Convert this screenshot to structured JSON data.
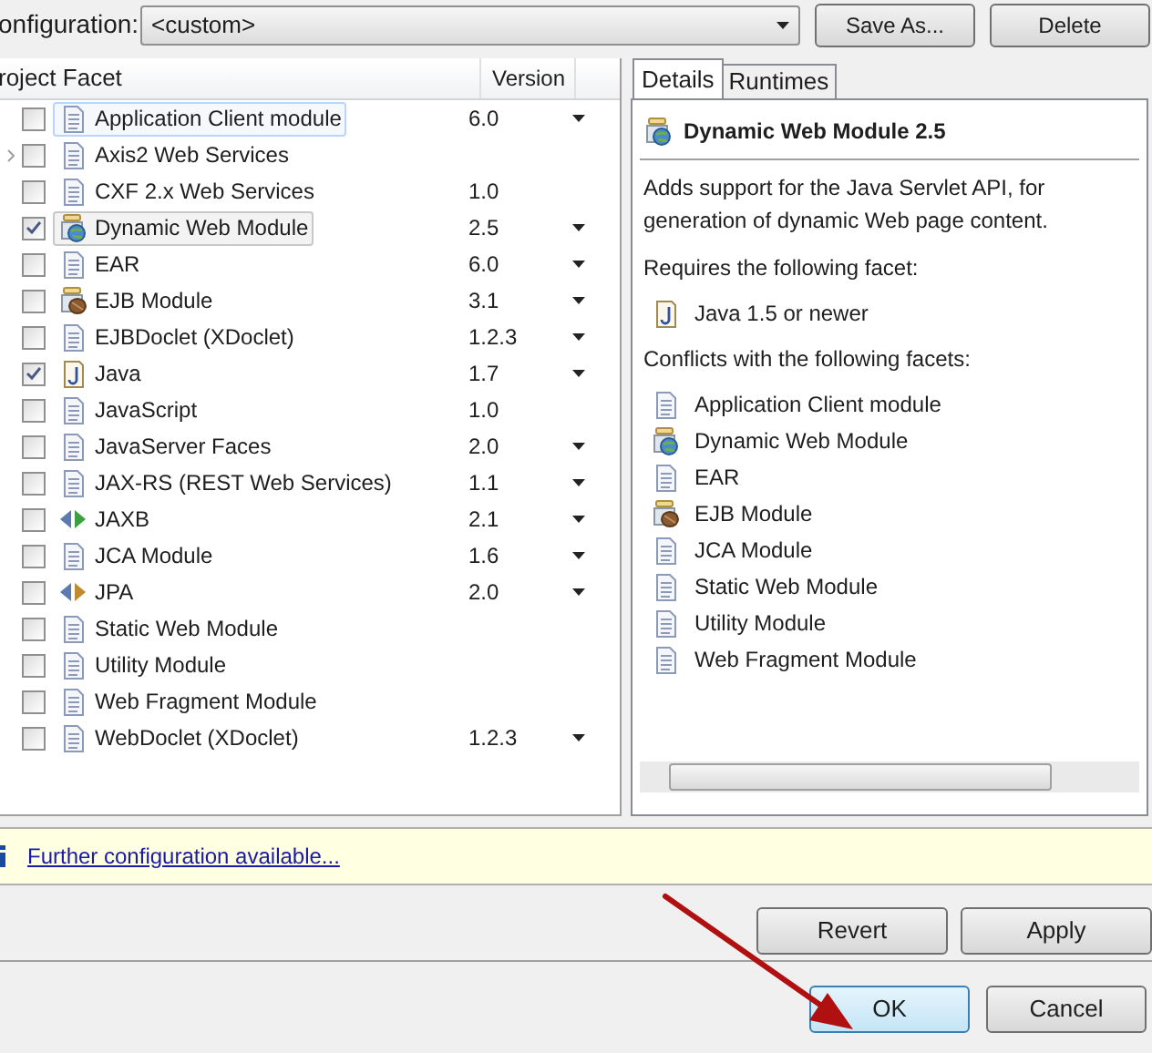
{
  "configuration": {
    "label": "onfiguration:",
    "value": "<custom>",
    "buttons": [
      "Save As...",
      "Delete"
    ]
  },
  "table": {
    "columns": [
      "roject Facet",
      "Version"
    ],
    "rows": [
      {
        "name": "Application Client module",
        "kind": "doc",
        "checked": false,
        "version": "6.0",
        "has_dropdown": true,
        "expandable": false,
        "hovered": true,
        "selected": false
      },
      {
        "name": "Axis2 Web Services",
        "kind": "doc",
        "checked": false,
        "has_dropdown": false,
        "expandable": true,
        "hovered": false,
        "selected": false
      },
      {
        "name": "CXF 2.x Web Services",
        "kind": "doc",
        "checked": false,
        "version": "1.0",
        "has_dropdown": false,
        "expandable": false,
        "hovered": false,
        "selected": false
      },
      {
        "name": "Dynamic Web Module",
        "kind": "web",
        "checked": true,
        "version": "2.5",
        "has_dropdown": true,
        "expandable": false,
        "hovered": false,
        "selected": true
      },
      {
        "name": "EAR",
        "kind": "doc",
        "checked": false,
        "version": "6.0",
        "has_dropdown": true,
        "expandable": false,
        "hovered": false,
        "selected": false
      },
      {
        "name": "EJB Module",
        "kind": "bean",
        "checked": false,
        "version": "3.1",
        "has_dropdown": true,
        "expandable": false,
        "hovered": false,
        "selected": false
      },
      {
        "name": "EJBDoclet (XDoclet)",
        "kind": "doc",
        "checked": false,
        "version": "1.2.3",
        "has_dropdown": true,
        "expandable": false,
        "hovered": false,
        "selected": false
      },
      {
        "name": "Java",
        "kind": "java",
        "checked": true,
        "version": "1.7",
        "has_dropdown": true,
        "expandable": false,
        "hovered": false,
        "selected": false
      },
      {
        "name": "JavaScript",
        "kind": "doc",
        "checked": false,
        "version": "1.0",
        "has_dropdown": false,
        "expandable": false,
        "hovered": false,
        "selected": false
      },
      {
        "name": "JavaServer Faces",
        "kind": "doc",
        "checked": false,
        "version": "2.0",
        "has_dropdown": true,
        "expandable": false,
        "hovered": false,
        "selected": false
      },
      {
        "name": "JAX-RS (REST Web Services)",
        "kind": "doc",
        "checked": false,
        "version": "1.1",
        "has_dropdown": true,
        "expandable": false,
        "hovered": false,
        "selected": false
      },
      {
        "name": "JAXB",
        "kind": "jaxb",
        "checked": false,
        "version": "2.1",
        "has_dropdown": true,
        "expandable": false,
        "hovered": false,
        "selected": false
      },
      {
        "name": "JCA Module",
        "kind": "doc",
        "checked": false,
        "version": "1.6",
        "has_dropdown": true,
        "expandable": false,
        "hovered": false,
        "selected": false
      },
      {
        "name": "JPA",
        "kind": "jpa",
        "checked": false,
        "version": "2.0",
        "has_dropdown": true,
        "expandable": false,
        "hovered": false,
        "selected": false
      },
      {
        "name": "Static Web Module",
        "kind": "doc",
        "checked": false,
        "has_dropdown": false,
        "expandable": false,
        "hovered": false,
        "selected": false
      },
      {
        "name": "Utility Module",
        "kind": "doc",
        "checked": false,
        "has_dropdown": false,
        "expandable": false,
        "hovered": false,
        "selected": false
      },
      {
        "name": "Web Fragment Module",
        "kind": "doc",
        "checked": false,
        "has_dropdown": false,
        "expandable": false,
        "hovered": false,
        "selected": false
      },
      {
        "name": "WebDoclet (XDoclet)",
        "kind": "doc",
        "checked": false,
        "version": "1.2.3",
        "has_dropdown": true,
        "expandable": false,
        "hovered": false,
        "selected": false
      }
    ]
  },
  "details": {
    "tabs": [
      {
        "label": "Details",
        "selected": true
      },
      {
        "label": "Runtimes",
        "selected": false
      }
    ],
    "title": {
      "text": "Dynamic Web Module 2.5",
      "kind": "web"
    },
    "description": "Adds support for the Java Servlet API, for generation of dynamic Web page content.",
    "requires_heading": "Requires the following facet:",
    "requires": [
      {
        "name": "Java 1.5 or newer",
        "kind": "java"
      }
    ],
    "conflicts_heading": "Conflicts with the following facets:",
    "conflicts": [
      {
        "name": "Application Client module",
        "kind": "doc"
      },
      {
        "name": "Dynamic Web Module",
        "kind": "web"
      },
      {
        "name": "EAR",
        "kind": "doc"
      },
      {
        "name": "EJB Module",
        "kind": "bean"
      },
      {
        "name": "JCA Module",
        "kind": "doc"
      },
      {
        "name": "Static Web Module",
        "kind": "doc"
      },
      {
        "name": "Utility Module",
        "kind": "doc"
      },
      {
        "name": "Web Fragment Module",
        "kind": "doc"
      }
    ]
  },
  "info_bar": {
    "link": "Further configuration available..."
  },
  "buttons": [
    {
      "label": "Revert",
      "default": false
    },
    {
      "label": "Apply",
      "default": false
    }
  ],
  "dialog_buttons": [
    {
      "label": "OK",
      "default": true
    },
    {
      "label": "Cancel",
      "default": false
    }
  ]
}
